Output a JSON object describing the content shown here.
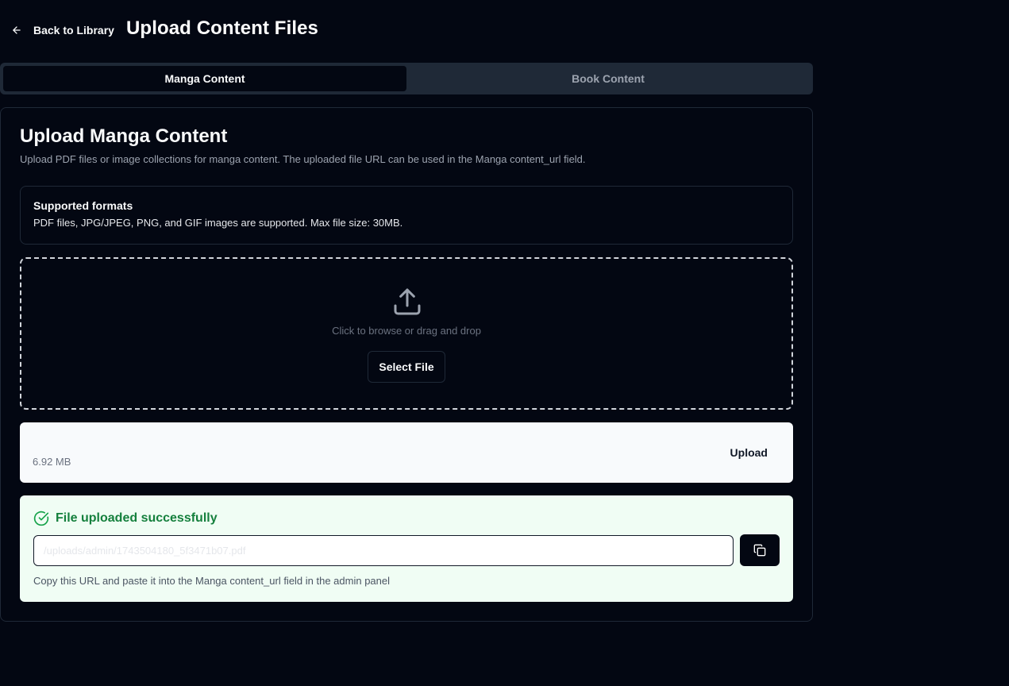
{
  "header": {
    "back_label": "Back to Library",
    "title": "Upload Content Files"
  },
  "tabs": [
    {
      "label": "Manga Content",
      "active": true
    },
    {
      "label": "Book Content",
      "active": false
    }
  ],
  "card": {
    "title": "Upload Manga Content",
    "description": "Upload PDF files or image collections for manga content. The uploaded file URL can be used in the Manga content_url field."
  },
  "formats": {
    "title": "Supported formats",
    "text": "PDF files, JPG/JPEG, PNG, and GIF images are supported. Max file size: 30MB."
  },
  "dropzone": {
    "icon": "upload-icon",
    "text": "Click to browse or drag and drop",
    "button_label": "Select File"
  },
  "file": {
    "size": "6.92 MB",
    "upload_label": "Upload"
  },
  "success": {
    "icon": "check-circle-icon",
    "title": "File uploaded successfully",
    "url_value": "/uploads/admin/1743504180_5f3471b07.pdf",
    "copy_icon": "copy-icon",
    "hint": "Copy this URL and paste it into the Manga content_url field in the admin panel"
  },
  "colors": {
    "background": "#030712",
    "tab_bar": "#1f2937",
    "success_bg": "#f0fdf4",
    "success_text": "#15803d",
    "file_row_bg": "#f8fafc"
  }
}
